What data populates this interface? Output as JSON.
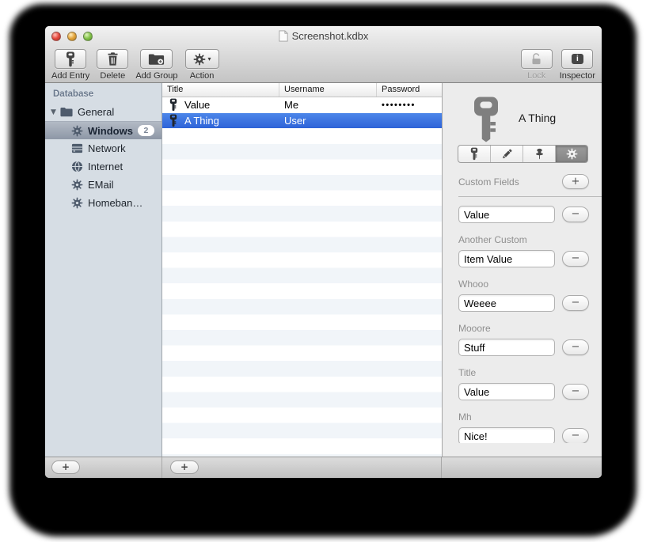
{
  "window": {
    "title": "Screenshot.kdbx"
  },
  "toolbar": {
    "add_entry": "Add Entry",
    "delete": "Delete",
    "add_group": "Add Group",
    "action": "Action",
    "lock": "Lock",
    "inspector": "Inspector"
  },
  "sidebar": {
    "header": "Database",
    "general": "General",
    "items": [
      {
        "label": "Windows",
        "icon": "gear-icon",
        "badge": "2",
        "selected": true
      },
      {
        "label": "Network",
        "icon": "server-icon"
      },
      {
        "label": "Internet",
        "icon": "globe-icon"
      },
      {
        "label": "EMail",
        "icon": "gear-icon"
      },
      {
        "label": "Homeban…",
        "icon": "gear-icon"
      }
    ]
  },
  "entry_list": {
    "columns": [
      "Title",
      "Username",
      "Password"
    ],
    "rows": [
      {
        "title": "Value",
        "username": "Me",
        "password": "••••••••"
      },
      {
        "title": "A Thing",
        "username": "User",
        "password": ""
      }
    ]
  },
  "inspector": {
    "entry_title": "A Thing",
    "custom_fields_label": "Custom Fields",
    "fields": [
      {
        "label": "",
        "value": "Value"
      },
      {
        "label": "Another Custom",
        "value": "Item Value"
      },
      {
        "label": "Whooo",
        "value": "Weeee"
      },
      {
        "label": "Mooore",
        "value": "Stuff"
      },
      {
        "label": "Title",
        "value": "Value"
      },
      {
        "label": "Mh",
        "value": "Nice!"
      }
    ]
  },
  "icons": {
    "plus": "+",
    "minus": "−",
    "chevron": "▾",
    "triangle": "▼"
  },
  "colors": {
    "selection_blue": "#3a74dc",
    "sidebar_selection": "#99a3b1",
    "sidebar_bg": "#d6dde4"
  }
}
